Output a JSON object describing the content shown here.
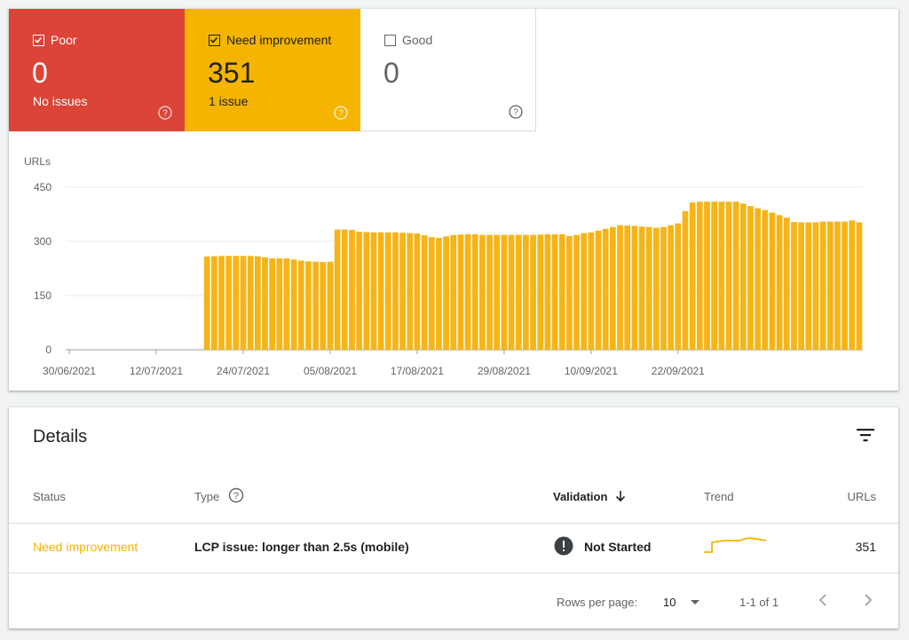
{
  "tiles": [
    {
      "label": "Poor",
      "count": "0",
      "sub": "No issues",
      "checked": true
    },
    {
      "label": "Need improvement",
      "count": "351",
      "sub": "1 issue",
      "checked": true
    },
    {
      "label": "Good",
      "count": "0",
      "sub": "",
      "checked": false
    }
  ],
  "colors": {
    "poor": "#db4437",
    "need": "#f4b400",
    "good": "#ffffff",
    "bar": "#f6b417"
  },
  "chart_data": {
    "type": "bar",
    "title": "",
    "ylabel": "URLs",
    "ylim": [
      0,
      450
    ],
    "yticks": [
      "0",
      "150",
      "300",
      "450"
    ],
    "xtick_labels": [
      "30/06/2021",
      "12/07/2021",
      "24/07/2021",
      "05/08/2021",
      "17/08/2021",
      "29/08/2021",
      "10/09/2021",
      "22/09/2021"
    ],
    "start_date": "30/06/2021",
    "grid": true,
    "series": [
      {
        "values": [
          0,
          0,
          0,
          0,
          0,
          0,
          0,
          0,
          0,
          0,
          0,
          0,
          0,
          0,
          0,
          0,
          0,
          0,
          0,
          258,
          259,
          260,
          260,
          260,
          260,
          260,
          259,
          256,
          253,
          253,
          253,
          250,
          247,
          245,
          244,
          243,
          244,
          333,
          333,
          332,
          327,
          326,
          325,
          325,
          325,
          325,
          324,
          323,
          322,
          317,
          312,
          310,
          314,
          318,
          319,
          320,
          320,
          318,
          318,
          318,
          318,
          318,
          318,
          318,
          318,
          319,
          320,
          320,
          320,
          315,
          318,
          323,
          325,
          330,
          335,
          340,
          345,
          344,
          343,
          341,
          340,
          338,
          340,
          345,
          350,
          384,
          408,
          410,
          410,
          410,
          410,
          410,
          410,
          405,
          398,
          392,
          387,
          380,
          373,
          366,
          354,
          353,
          353,
          353,
          355,
          355,
          355,
          355,
          358,
          353
        ]
      }
    ]
  },
  "details": {
    "title": "Details",
    "columns": {
      "status": "Status",
      "type": "Type",
      "validation": "Validation",
      "trend": "Trend",
      "urls": "URLs"
    },
    "rows": [
      {
        "status": "Need improvement",
        "type": "LCP issue: longer than 2.5s (mobile)",
        "validation": "Not Started",
        "urls": "351"
      }
    ],
    "footer": {
      "rows_per_page_label": "Rows per page:",
      "rows_per_page": "10",
      "range": "1-1 of 1"
    }
  }
}
